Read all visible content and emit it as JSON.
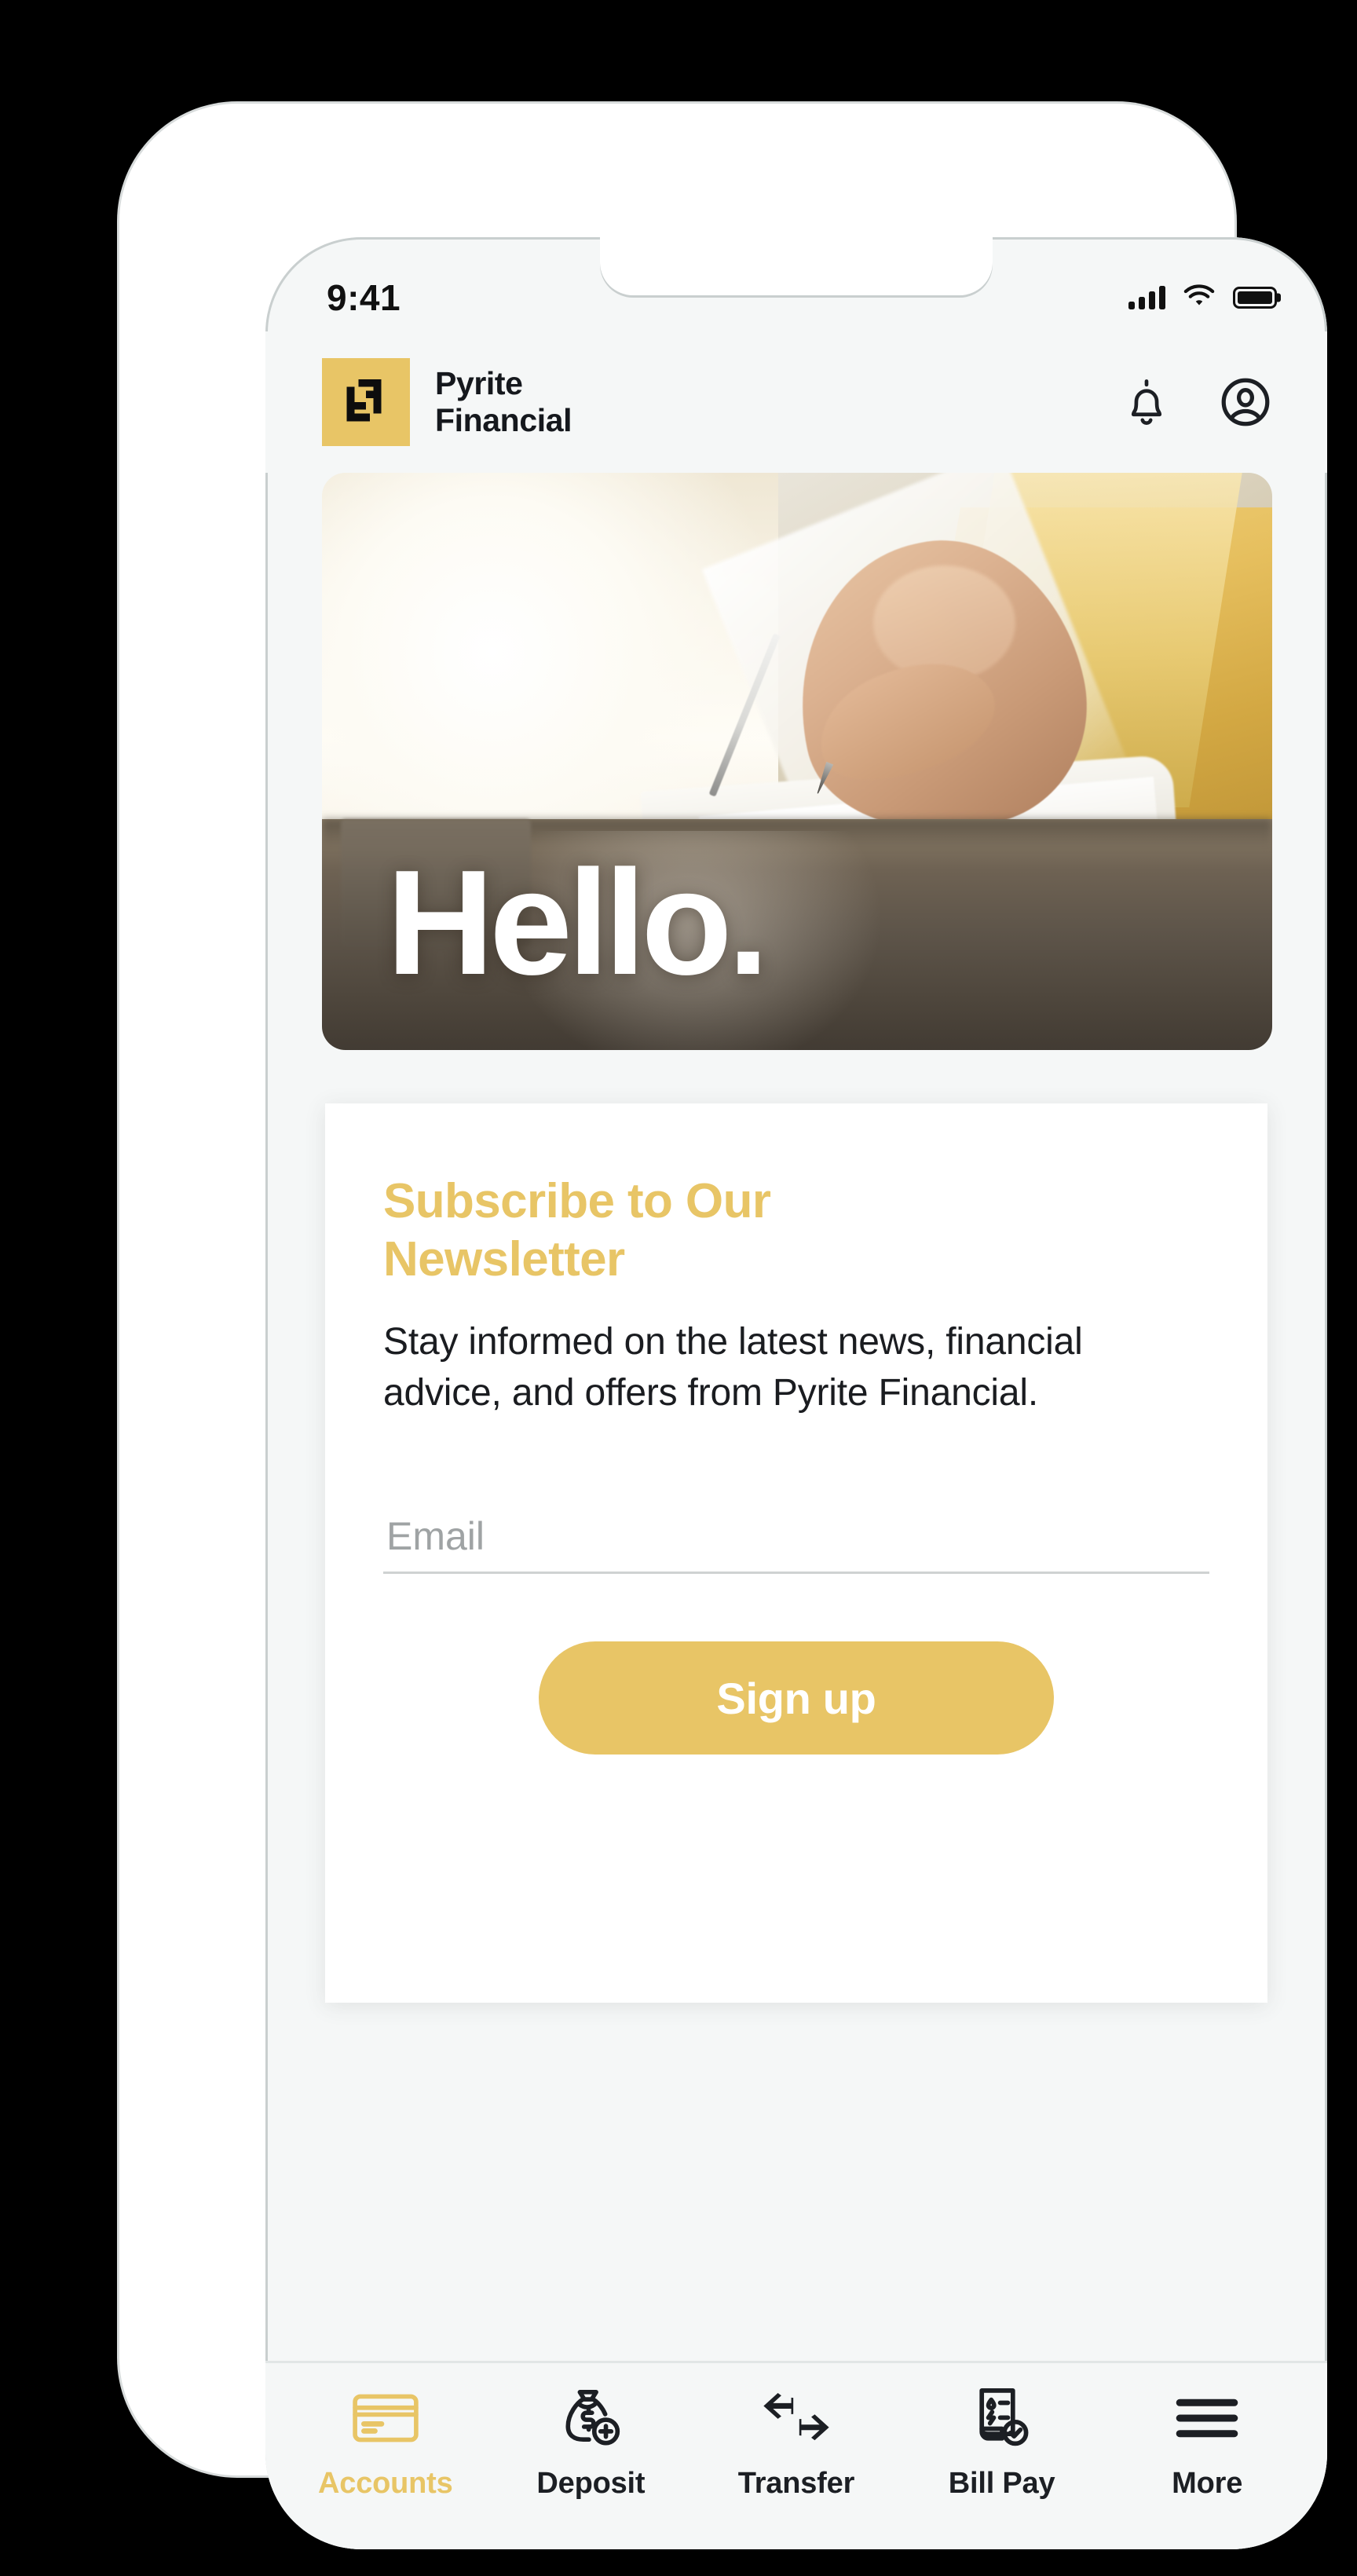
{
  "colors": {
    "accent_gold": "#e8c566",
    "text_dark": "#15181d",
    "app_background": "#f5f7f7",
    "card_background": "#ffffff",
    "placeholder_gray": "#9fa3a4"
  },
  "status_bar": {
    "time": "9:41",
    "signal_icon": "cellular-signal-icon",
    "wifi_icon": "wifi-icon",
    "battery_icon": "battery-full-icon"
  },
  "header": {
    "logo_icon": "pyrite-logo-icon",
    "brand_name": "Pyrite\nFinancial",
    "notifications_icon": "bell-icon",
    "account_icon": "user-circle-icon"
  },
  "hero": {
    "title": "Hello.",
    "image_description": "person writing in a notebook at a desk"
  },
  "newsletter": {
    "title": "Subscribe to Our\nNewsletter",
    "body": "Stay informed on the latest news, financial advice, and offers from Pyrite Financial.",
    "email_placeholder": "Email",
    "email_value": "",
    "signup_label": "Sign up"
  },
  "bottom_nav": {
    "items": [
      {
        "label": "Accounts",
        "icon": "credit-card-icon",
        "active": true
      },
      {
        "label": "Deposit",
        "icon": "money-bag-plus-icon",
        "active": false
      },
      {
        "label": "Transfer",
        "icon": "transfer-arrows-icon",
        "active": false
      },
      {
        "label": "Bill Pay",
        "icon": "invoice-check-icon",
        "active": false
      },
      {
        "label": "More",
        "icon": "hamburger-menu-icon",
        "active": false
      }
    ]
  }
}
